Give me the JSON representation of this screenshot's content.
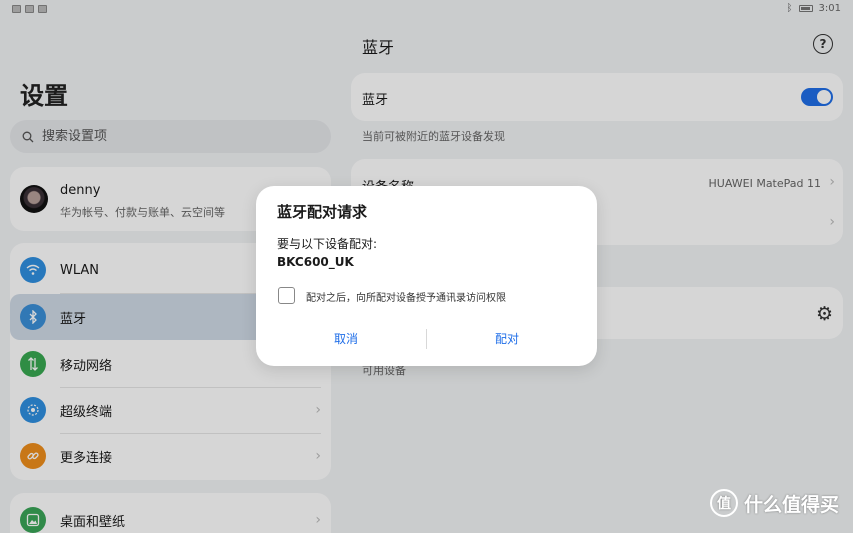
{
  "status_bar": {
    "time": "3:01"
  },
  "left": {
    "title": "设置",
    "search_placeholder": "搜索设置项",
    "account": {
      "name": "denny",
      "subtitle": "华为帐号、付款与账单、云空间等"
    },
    "menu": [
      {
        "label": "WLAN",
        "icon": "wifi-icon",
        "color": "#2f8fe0"
      },
      {
        "label": "蓝牙",
        "icon": "bluetooth-icon",
        "color": "#3b8fd8"
      },
      {
        "label": "移动网络",
        "icon": "mobile-network-icon",
        "color": "#39a852"
      },
      {
        "label": "超级终端",
        "icon": "super-device-icon",
        "color": "#2f8fe0"
      },
      {
        "label": "更多连接",
        "icon": "link-icon",
        "color": "#ef8e1c"
      }
    ],
    "menu2": [
      {
        "label": "桌面和壁纸",
        "icon": "wallpaper-icon",
        "color": "#3aa557"
      }
    ]
  },
  "right": {
    "title": "蓝牙",
    "bluetooth_label": "蓝牙",
    "bluetooth_on": true,
    "visibility_note": "当前可被附近的蓝牙设备发现",
    "device_name_label": "设备名称",
    "device_name_value": "HUAWEI MatePad 11",
    "available_devices_label": "可用设备"
  },
  "dialog": {
    "title": "蓝牙配对请求",
    "message": "要与以下设备配对:",
    "device": "BKC600_UK",
    "checkbox_label": "配对之后，向所配对设备授予通讯录访问权限",
    "cancel_label": "取消",
    "pair_label": "配对"
  },
  "colors": {
    "accent": "#1f6ee8",
    "selected_bg": "#d0dae6"
  },
  "watermark": {
    "text": "什么值得买",
    "badge": "值"
  }
}
